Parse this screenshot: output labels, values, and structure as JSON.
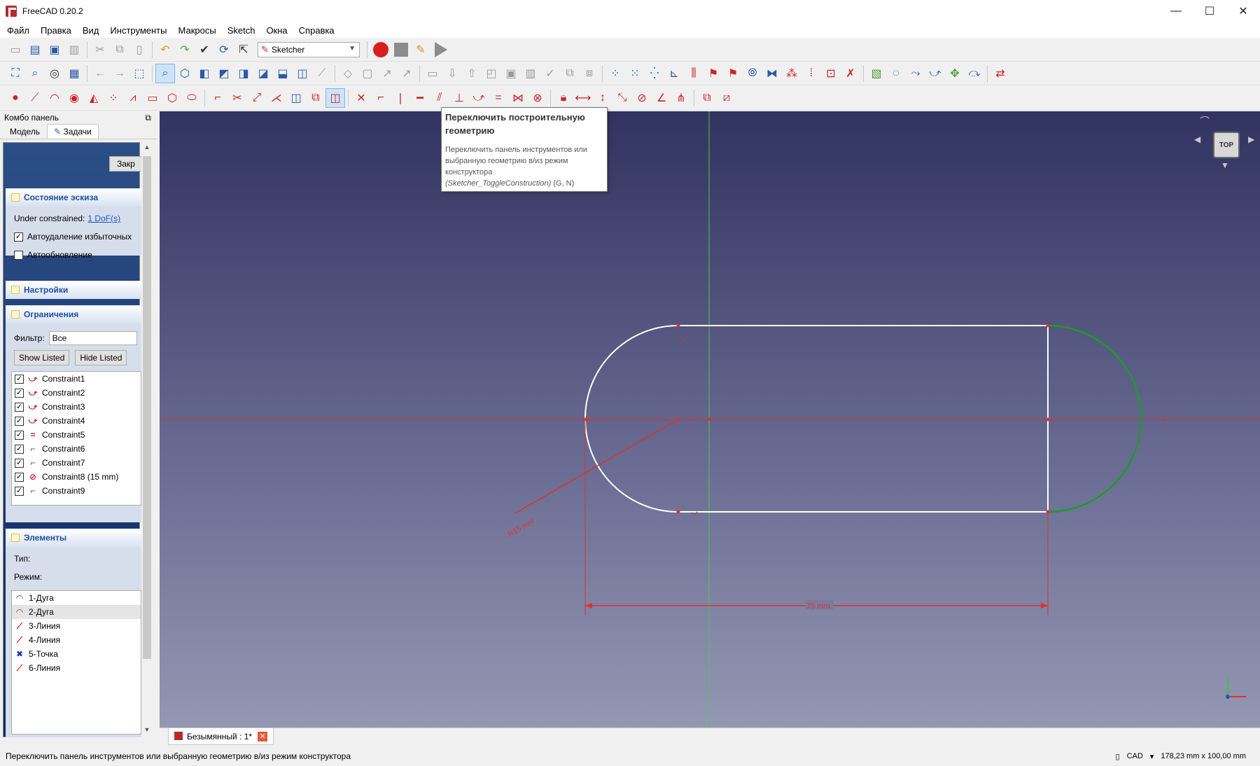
{
  "window": {
    "title": "FreeCAD 0.20.2",
    "controls": [
      "—",
      "☐",
      "✕"
    ]
  },
  "menu": [
    "Файл",
    "Правка",
    "Вид",
    "Инструменты",
    "Макросы",
    "Sketch",
    "Окна",
    "Справка"
  ],
  "workbench": {
    "selected": "Sketcher"
  },
  "combo": {
    "title": "Комбо панель",
    "tabs": [
      "Модель",
      "Задачи"
    ],
    "close_label": "Закр",
    "sketch_state": {
      "title": "Состояние эскиза",
      "under_constrained": "Under constrained:",
      "dof_link": "1 DoF(s)",
      "auto_remove": "Автоудаление избыточных",
      "auto_update": "Автообновление"
    },
    "settings_title": "Настройки",
    "constraints": {
      "title": "Ограничения",
      "filter_label": "Фильтр:",
      "filter_value": "Все",
      "show_listed": "Show Listed",
      "hide_listed": "Hide Listed",
      "items": [
        {
          "label": "Constraint1",
          "icon": "tangent-icon"
        },
        {
          "label": "Constraint2",
          "icon": "tangent-icon"
        },
        {
          "label": "Constraint3",
          "icon": "tangent-icon"
        },
        {
          "label": "Constraint4",
          "icon": "tangent-icon"
        },
        {
          "label": "Constraint5",
          "icon": "equal-icon"
        },
        {
          "label": "Constraint6",
          "icon": "coincident-icon"
        },
        {
          "label": "Constraint7",
          "icon": "coincident-icon"
        },
        {
          "label": "Constraint8 (15 mm)",
          "icon": "radius-icon"
        },
        {
          "label": "Constraint9",
          "icon": "coincident-icon"
        }
      ]
    },
    "elements": {
      "title": "Элементы",
      "type_label": "Тип:",
      "mode_label": "Режим:",
      "items": [
        {
          "label": "1-Дуга",
          "icon": "arc-icon"
        },
        {
          "label": "2-Дуга",
          "icon": "arc-icon"
        },
        {
          "label": "3-Линия",
          "icon": "line-icon"
        },
        {
          "label": "4-Линия",
          "icon": "line-icon"
        },
        {
          "label": "5-Точка",
          "icon": "point-icon"
        },
        {
          "label": "6-Линия",
          "icon": "line-icon"
        }
      ]
    }
  },
  "tooltip": {
    "title": "Переключить построительную геометрию",
    "desc": "Переключить панель инструментов или выбранную геометрию в/из режим конструктора",
    "command": "(Sketcher_ToggleConstruction)",
    "shortcut": " (G, N)"
  },
  "viewport": {
    "dimension_length": "75 mm",
    "dimension_radius": "R15 mm",
    "navcube_face": "TOP"
  },
  "document_tab": {
    "label": "Безымянный : 1*"
  },
  "status": {
    "message": "Переключить панель инструментов или выбранную геометрию в/из режим конструктора",
    "nav_style": "CAD",
    "dimensions": "178,23 mm x 100,00 mm"
  }
}
